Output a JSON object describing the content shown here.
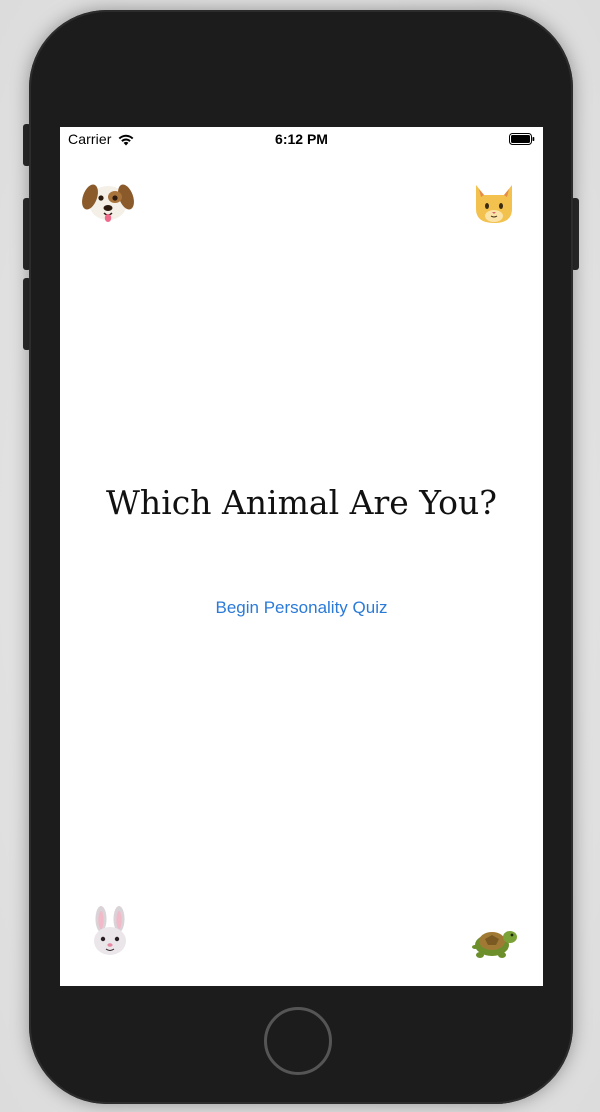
{
  "status_bar": {
    "carrier": "Carrier",
    "time": "6:12 PM",
    "wifi_icon": "wifi-icon",
    "battery_icon": "battery-icon"
  },
  "screen": {
    "title": "Which Animal Are You?",
    "begin_button": "Begin Personality Quiz",
    "corner_icons": [
      "dog-face-icon",
      "cat-face-icon",
      "rabbit-face-icon",
      "turtle-icon"
    ]
  },
  "colors": {
    "accent": "#2a7ad8",
    "device_body": "#1c1c1c",
    "screen_background": "#ffffff"
  }
}
